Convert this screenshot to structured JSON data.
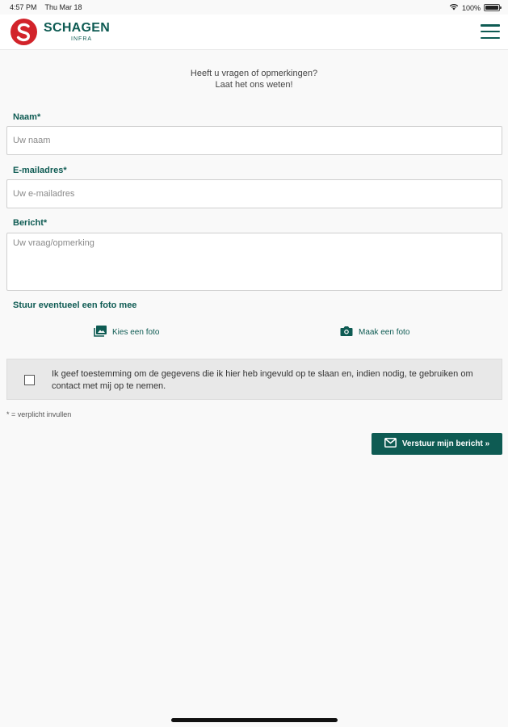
{
  "status_bar": {
    "time": "4:57 PM",
    "date": "Thu Mar 18",
    "battery": "100%"
  },
  "header": {
    "brand_name": "SCHAGEN",
    "brand_sub": "INFRA",
    "menu_icon": "hamburger-icon"
  },
  "intro": {
    "line1": "Heeft u vragen of opmerkingen?",
    "line2": "Laat het ons weten!"
  },
  "form": {
    "name": {
      "label": "Naam*",
      "placeholder": "Uw naam",
      "value": ""
    },
    "email": {
      "label": "E-mailadres*",
      "placeholder": "Uw e-mailadres",
      "value": ""
    },
    "message": {
      "label": "Bericht*",
      "placeholder": "Uw vraag/opmerking",
      "value": ""
    },
    "photo_heading": "Stuur eventueel een foto mee",
    "choose_photo": "Kies een foto",
    "take_photo": "Maak een foto",
    "consent_text": "Ik geef toestemming om de gegevens die ik hier heb ingevuld op te slaan en, indien nodig, te gebruiken om contact met mij op te nemen.",
    "consent_checked": false,
    "required_note": "* = verplicht invullen",
    "submit_label": "Verstuur mijn bericht »"
  },
  "colors": {
    "brand_green": "#0e5b53",
    "brand_red": "#d2232a",
    "background": "#f9f9f9"
  }
}
